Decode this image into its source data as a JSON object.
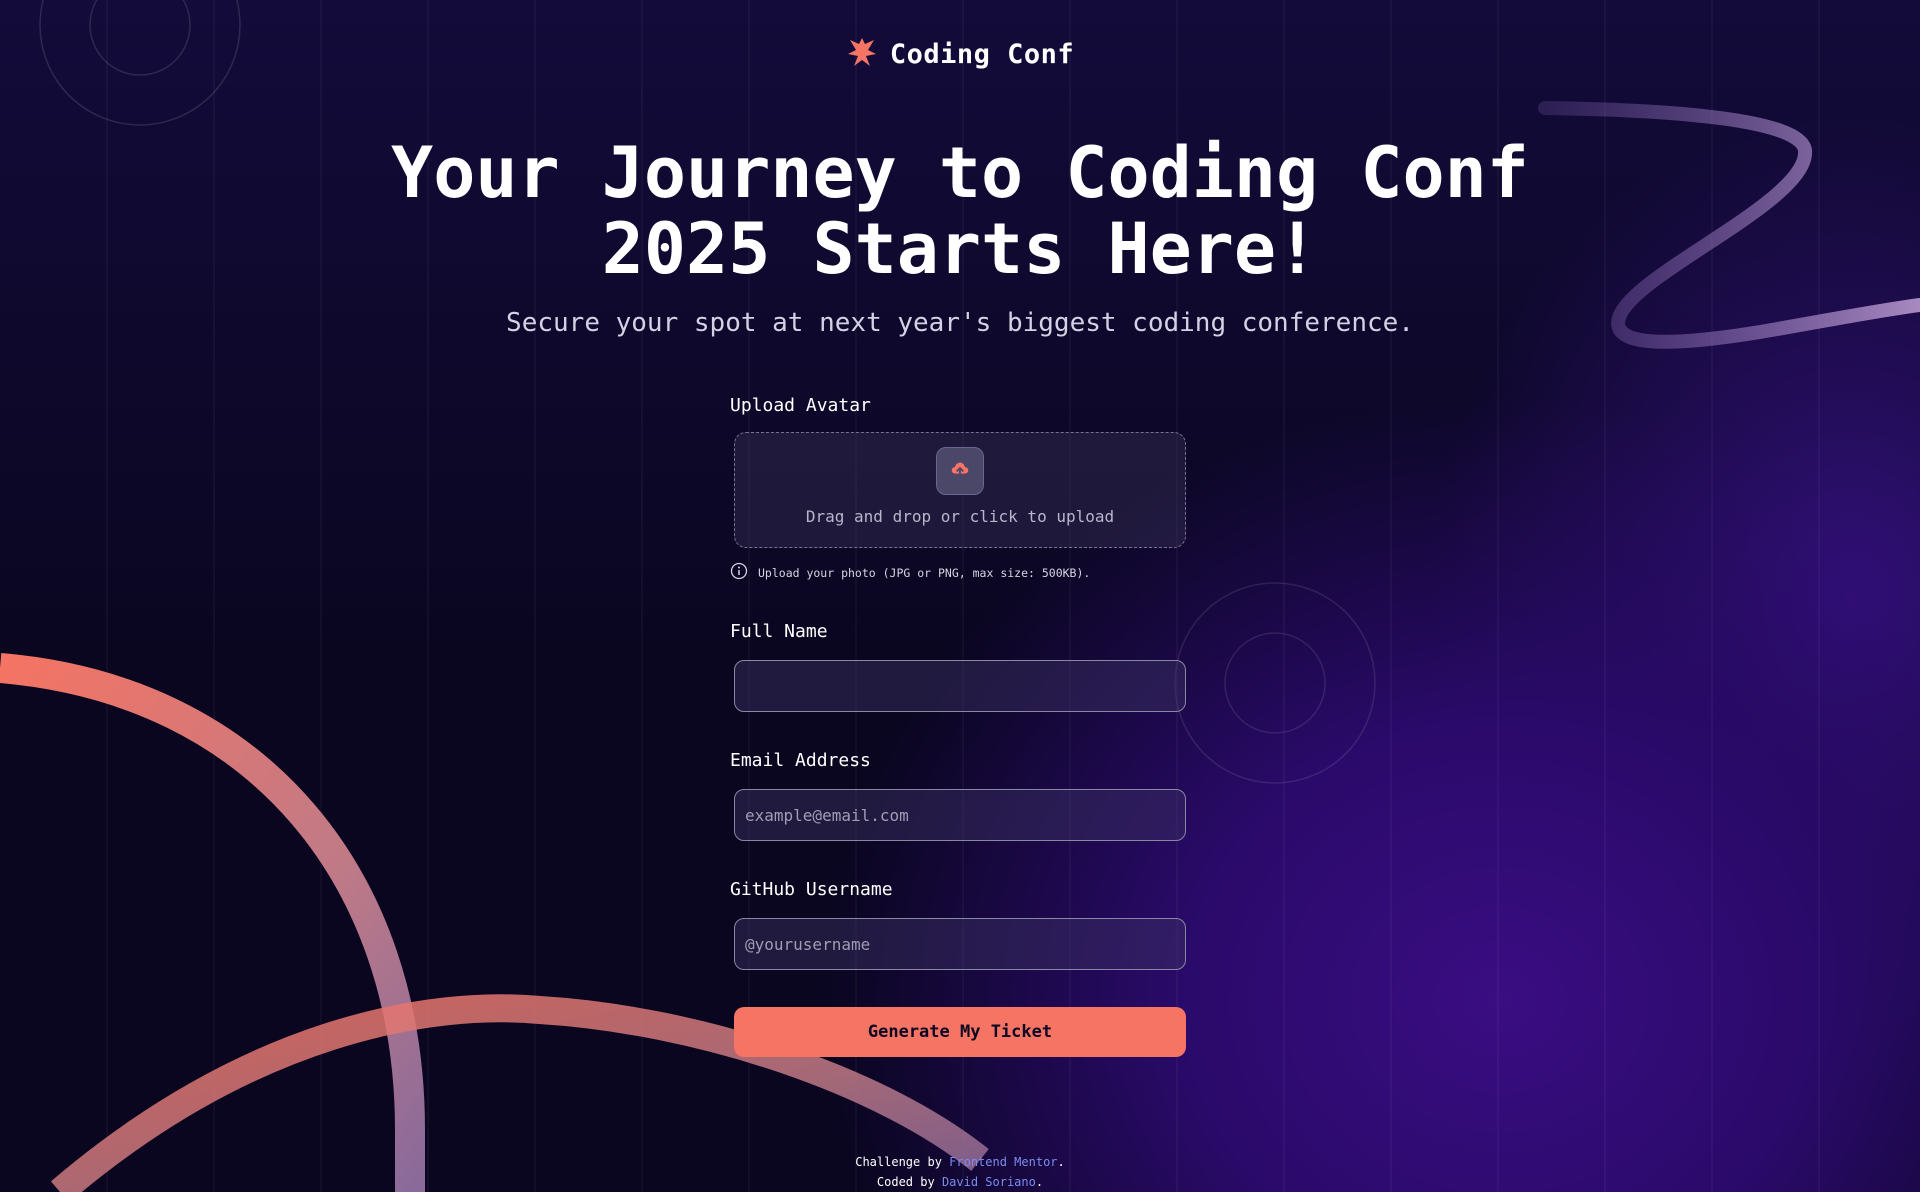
{
  "header": {
    "brand_name": "Coding Conf",
    "logo_icon": "coding-conf-logo-icon"
  },
  "hero": {
    "title": "Your Journey to Coding Conf 2025 Starts Here!",
    "subtitle": "Secure your spot at next year's biggest coding conference."
  },
  "form": {
    "upload": {
      "label": "Upload Avatar",
      "dropzone_text": "Drag and drop or click to upload",
      "hint": "Upload your photo (JPG or PNG, max size: 500KB).",
      "icon": "upload-cloud-icon",
      "hint_icon": "info-icon"
    },
    "full_name": {
      "label": "Full Name",
      "value": "",
      "placeholder": ""
    },
    "email": {
      "label": "Email Address",
      "value": "",
      "placeholder": "example@email.com"
    },
    "github": {
      "label": "GitHub Username",
      "value": "",
      "placeholder": "@yourusername"
    },
    "submit_label": "Generate My Ticket"
  },
  "footer": {
    "line1_prefix": "Challenge by ",
    "line1_link": "Frontend Mentor",
    "line1_suffix": ".",
    "line2_prefix": "Coded by ",
    "line2_link": "David Soriano",
    "line2_suffix": "."
  },
  "colors": {
    "accent": "#f57463",
    "background": "#0d0723",
    "link": "#7b8cf0",
    "purple_glow": "#3a0d82"
  }
}
